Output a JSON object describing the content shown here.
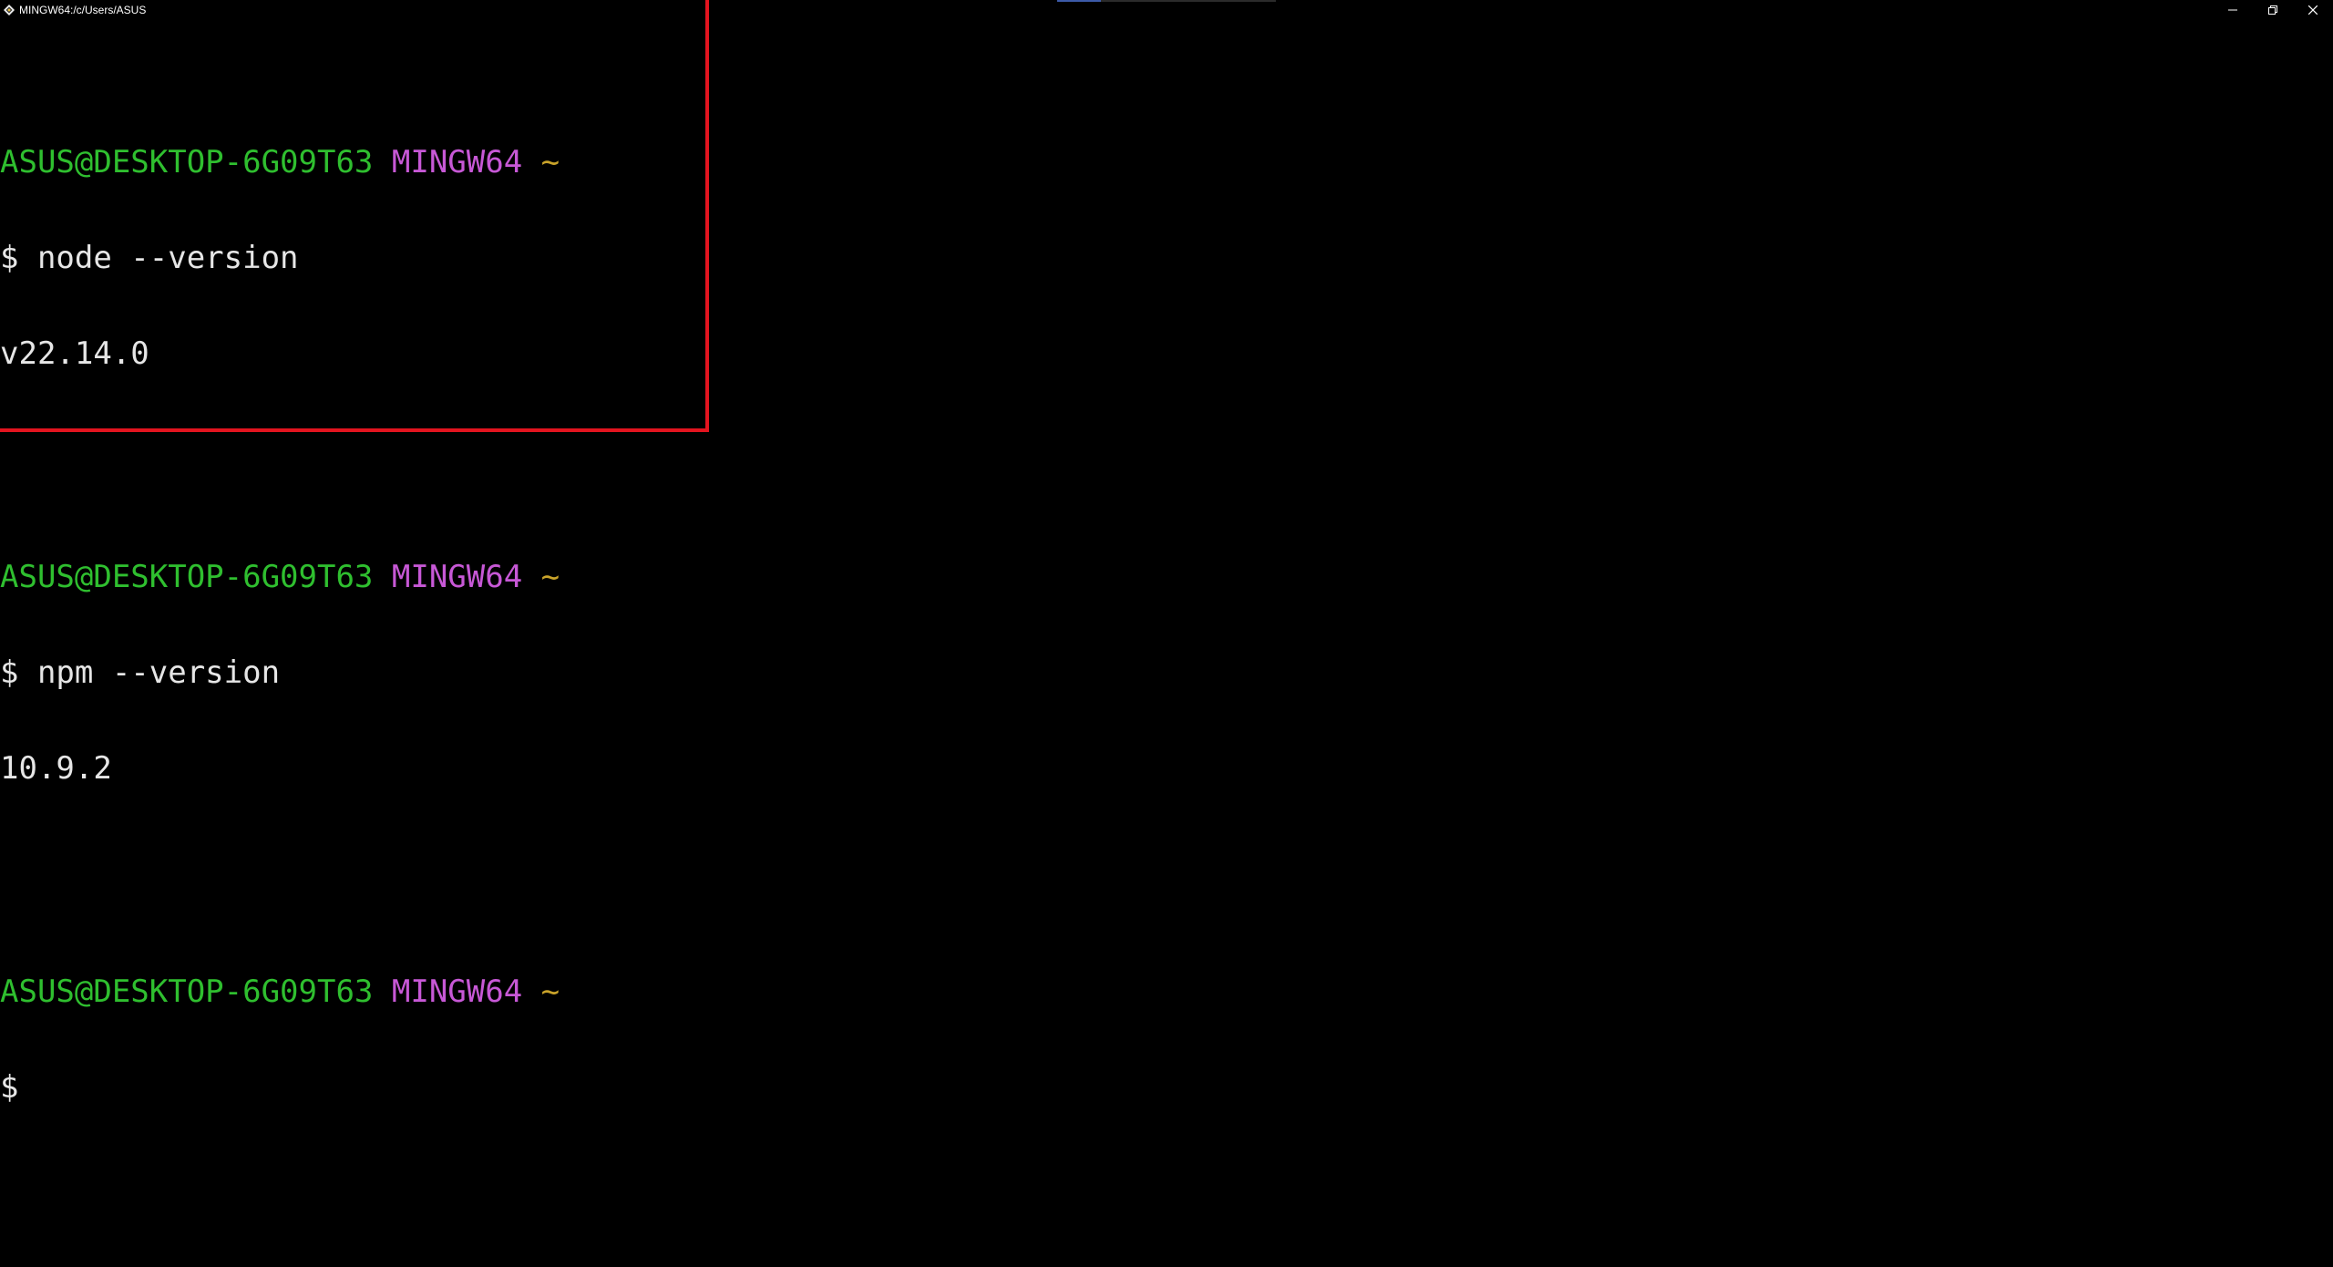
{
  "window": {
    "title": "MINGW64:/c/Users/ASUS",
    "controls": {
      "minimize": "minimize-icon",
      "restore": "restore-icon",
      "close": "close-icon"
    }
  },
  "colors": {
    "user_host": "#2fbf2f",
    "shell_name": "#c758d6",
    "path": "#c9a32a",
    "text": "#e6e6e6",
    "highlight_border": "#e3141f"
  },
  "terminal": {
    "blocks": [
      {
        "prompt": {
          "user_host": "ASUS@DESKTOP-6G09T63",
          "shell": "MINGW64",
          "path": "~"
        },
        "command": "$ node --version",
        "output": "v22.14.0"
      },
      {
        "prompt": {
          "user_host": "ASUS@DESKTOP-6G09T63",
          "shell": "MINGW64",
          "path": "~"
        },
        "command": "$ npm --version",
        "output": "10.9.2"
      },
      {
        "prompt": {
          "user_host": "ASUS@DESKTOP-6G09T63",
          "shell": "MINGW64",
          "path": "~"
        },
        "command": "$ ",
        "output": ""
      }
    ]
  }
}
